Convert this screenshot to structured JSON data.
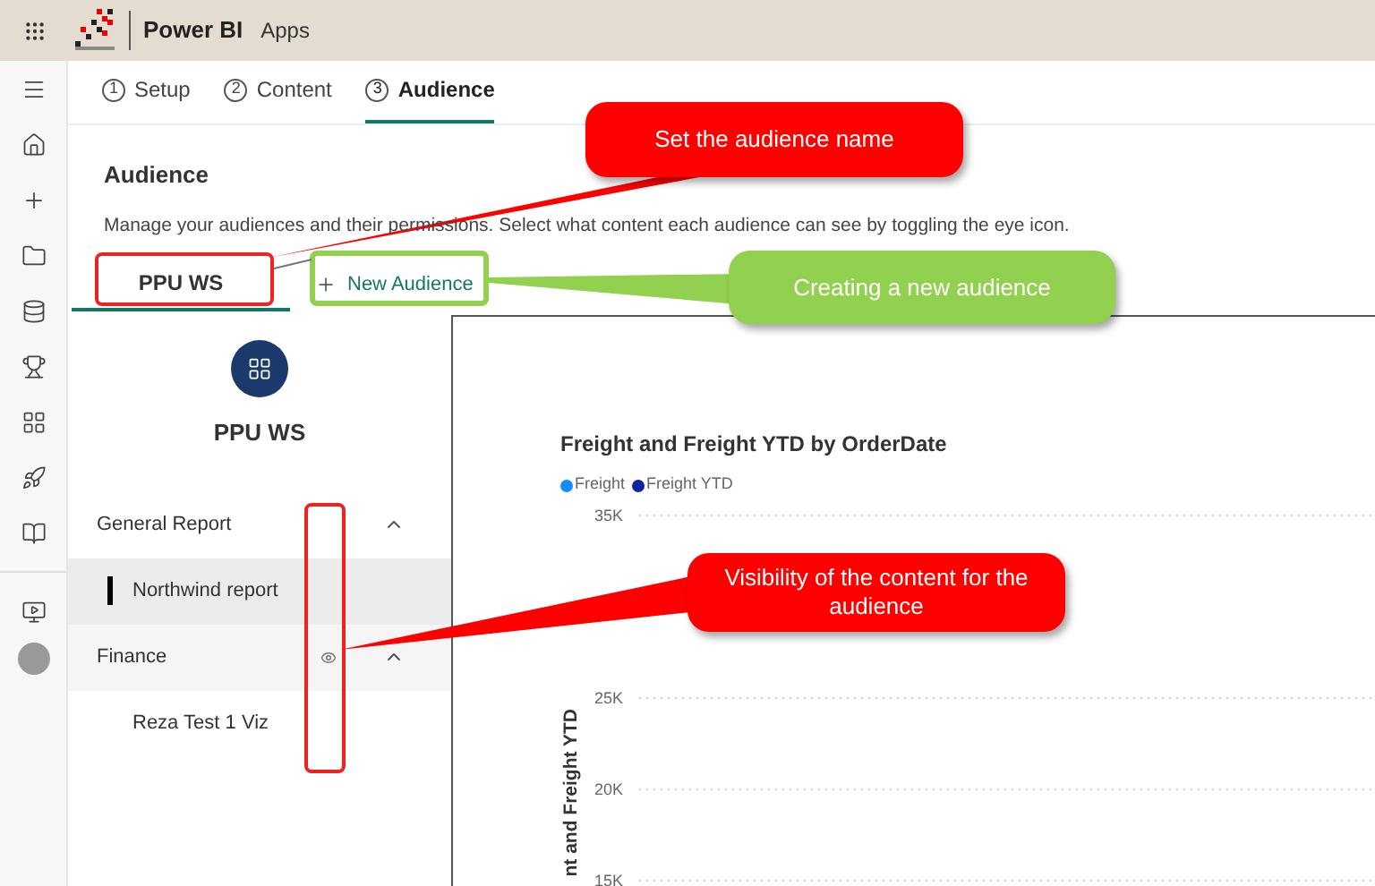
{
  "header": {
    "brand": "Power BI",
    "section": "Apps"
  },
  "steps": [
    {
      "number": "1",
      "label": "Setup",
      "selected": false
    },
    {
      "number": "2",
      "label": "Content",
      "selected": false
    },
    {
      "number": "3",
      "label": "Audience",
      "selected": true
    }
  ],
  "page": {
    "heading": "Audience",
    "description": "Manage your audiences and their permissions. Select what content each audience can see by toggling the eye icon."
  },
  "audience_tabs": [
    {
      "label": "PPU WS",
      "selected": true
    }
  ],
  "new_audience_button": "New Audience",
  "workspace": {
    "name": "PPU WS"
  },
  "sections": [
    {
      "title": "General Report",
      "expanded": true,
      "hovered": false,
      "items": [
        {
          "title": "Northwind report",
          "selected": true
        }
      ]
    },
    {
      "title": "Finance",
      "expanded": true,
      "hovered": true,
      "items": [
        {
          "title": "Reza Test 1 Viz",
          "selected": false
        }
      ]
    }
  ],
  "chart": {
    "chart_data": {
      "type": "line",
      "title": "Freight and Freight YTD by OrderDate",
      "ylabel": "nt and Freight YTD",
      "grid": true,
      "ylim": [
        15000,
        35000
      ],
      "yticks": [
        {
          "value": 15000,
          "label": "15K"
        },
        {
          "value": 20000,
          "label": "20K"
        },
        {
          "value": 25000,
          "label": "25K"
        },
        {
          "value": 35000,
          "label": "35K"
        }
      ],
      "series": [
        {
          "name": "Freight",
          "color": "#118dff"
        },
        {
          "name": "Freight YTD",
          "color": "#12239e"
        }
      ]
    }
  },
  "callouts": [
    {
      "text": "Set the audience name",
      "color": "#ff0000"
    },
    {
      "text": "Creating a new audience",
      "color": "#92d050"
    },
    {
      "text": "Visibility of the content for the audience",
      "color": "#ff0000"
    }
  ]
}
